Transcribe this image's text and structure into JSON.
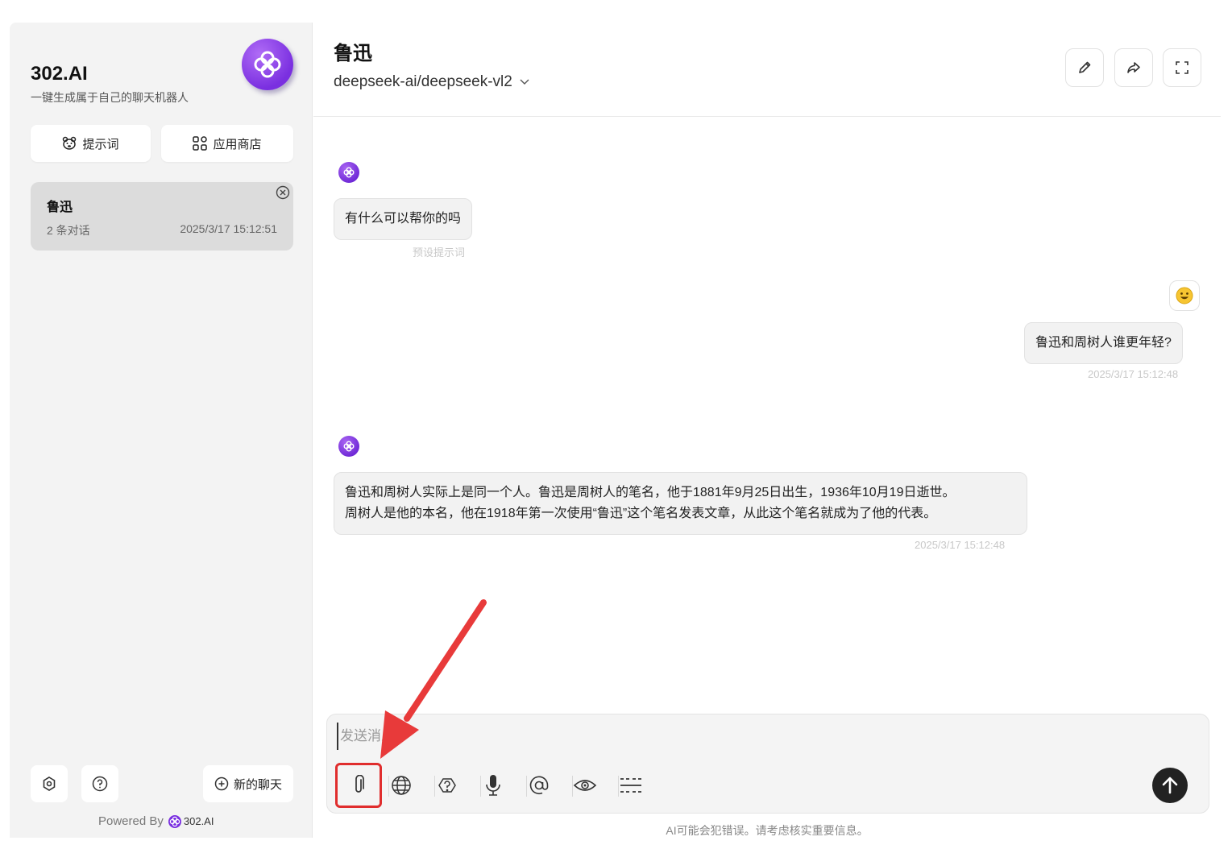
{
  "sidebar": {
    "brand_name": "302.AI",
    "brand_subtitle": "一键生成属于自己的聊天机器人",
    "prompts_label": "提示词",
    "store_label": "应用商店",
    "chats": [
      {
        "title": "鲁迅",
        "count": "2 条对话",
        "time": "2025/3/17 15:12:51"
      }
    ],
    "new_chat_label": "新的聊天",
    "powered_by": "Powered By",
    "powered_brand": "302.AI"
  },
  "header": {
    "title": "鲁迅",
    "model": "deepseek-ai/deepseek-vl2"
  },
  "messages": {
    "m1": {
      "text": "有什么可以帮你的吗",
      "meta": "预设提示词"
    },
    "m2": {
      "text": "鲁迅和周树人谁更年轻?",
      "meta": "2025/3/17 15:12:48"
    },
    "m3": {
      "line1": "鲁迅和周树人实际上是同一个人。鲁迅是周树人的笔名，他于1881年9月25日出生，1936年10月19日逝世。",
      "line2": "周树人是他的本名，他在1918年第一次使用“鲁迅”这个笔名发表文章，从此这个笔名就成为了他的代表。",
      "meta": "2025/3/17 15:12:48"
    }
  },
  "composer": {
    "placeholder": "发送消息",
    "disclaimer": "AI可能会犯错误。请考虑核实重要信息。"
  },
  "colors": {
    "accent": "#7a2fe0",
    "highlight": "#e02d2d"
  }
}
